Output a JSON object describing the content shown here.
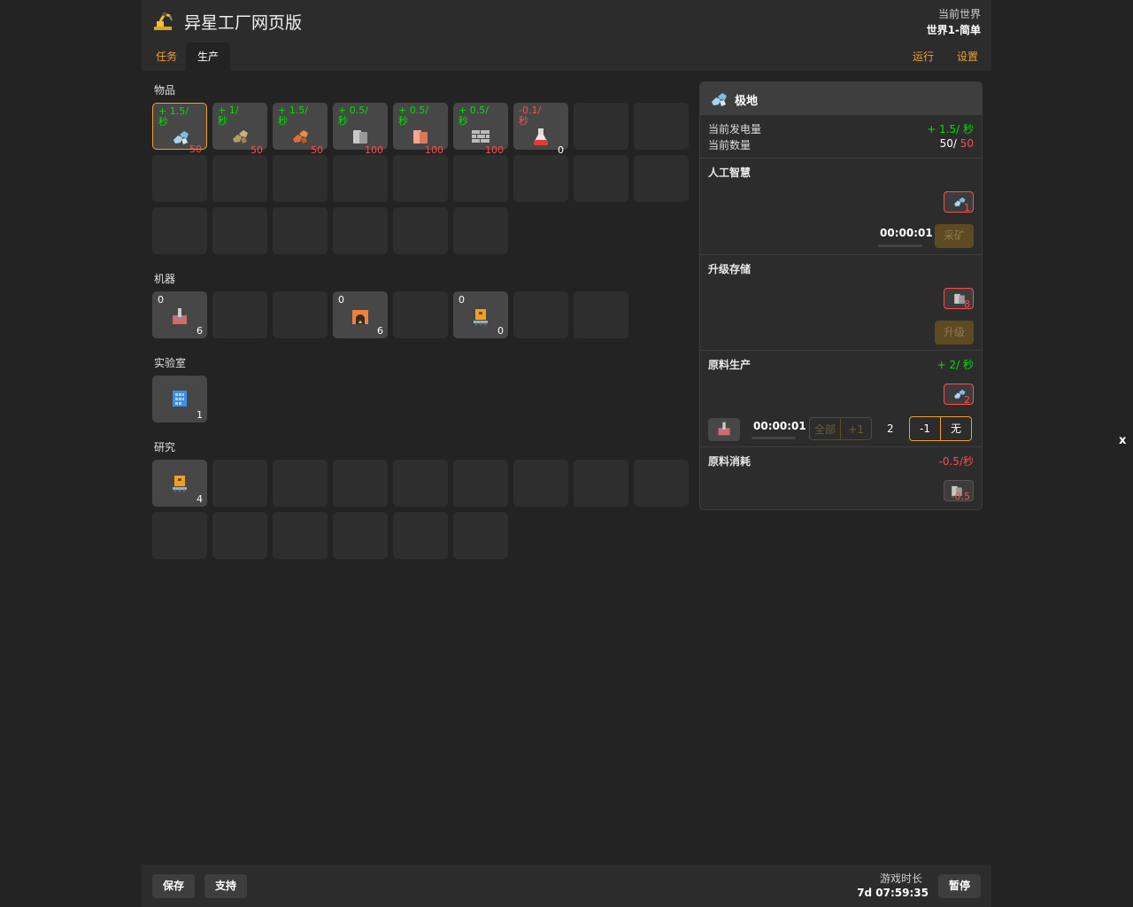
{
  "header": {
    "title": "异星工厂网页版",
    "world_label": "当前世界",
    "world_value": "世界1-简单"
  },
  "tabs": {
    "mission": "任务",
    "production": "生产",
    "run": "运行",
    "settings": "设置"
  },
  "items": {
    "title": "物品",
    "slots": [
      {
        "rate": "+ 1.5/ 秒",
        "cap": "50",
        "icon": "ice-ore-icon",
        "negative": false
      },
      {
        "rate": "+ 1/ 秒",
        "cap": "50",
        "icon": "stone-ore-icon",
        "negative": false
      },
      {
        "rate": "+ 1.5/ 秒",
        "cap": "50",
        "icon": "copper-ore-icon",
        "negative": false
      },
      {
        "rate": "+ 0.5/ 秒",
        "cap": "100",
        "icon": "iron-plate-icon",
        "negative": false
      },
      {
        "rate": "+ 0.5/ 秒",
        "cap": "100",
        "icon": "copper-plate-icon",
        "negative": false
      },
      {
        "rate": "+ 0.5/ 秒",
        "cap": "100",
        "icon": "stone-brick-icon",
        "negative": false
      },
      {
        "rate": "-0.1/ 秒",
        "cap": "0",
        "icon": "science-flask-icon",
        "negative": true
      }
    ]
  },
  "machines": {
    "title": "机器",
    "slots": [
      {
        "top": "0",
        "bottom": "6",
        "icon": "mining-drill-icon"
      },
      {
        "top": "0",
        "bottom": "6",
        "icon": "furnace-icon"
      },
      {
        "top": "0",
        "bottom": "0",
        "icon": "assembler-icon"
      }
    ]
  },
  "lab": {
    "title": "实验室",
    "count": "1",
    "icon": "lab-building-icon"
  },
  "research": {
    "title": "研究",
    "count": "4",
    "icon": "assembler-icon"
  },
  "panel": {
    "title": "极地",
    "power_label": "当前发电量",
    "power_value": "+ 1.5/ 秒",
    "amount_label": "当前数量",
    "amount_current": "50/",
    "amount_max": "50",
    "ai": {
      "title": "人工智慧",
      "req_count": "1",
      "timer": "00:00:01",
      "mine_label": "采矿"
    },
    "storage": {
      "title": "升级存储",
      "req_count": "8",
      "upgrade_label": "升级"
    },
    "produce": {
      "title": "原料生产",
      "rate": "+ 2/ 秒",
      "req_count": "2",
      "timer": "00:00:01",
      "all_label": "全部",
      "plus_label": "+1",
      "count": "2",
      "minus_label": "-1",
      "none_label": "无"
    },
    "consume": {
      "title": "原料消耗",
      "rate": "-0.5/秒",
      "req_count": "-0.5"
    }
  },
  "footer": {
    "save": "保存",
    "support": "支持",
    "game_time_label": "游戏时长",
    "game_time_value": "7d 07:59:35",
    "pause": "暂停"
  },
  "close_label": "x",
  "colors": {
    "accent": "#f0a030",
    "positive": "#00e000",
    "negative": "#ff4d4d",
    "background": "#232323"
  }
}
